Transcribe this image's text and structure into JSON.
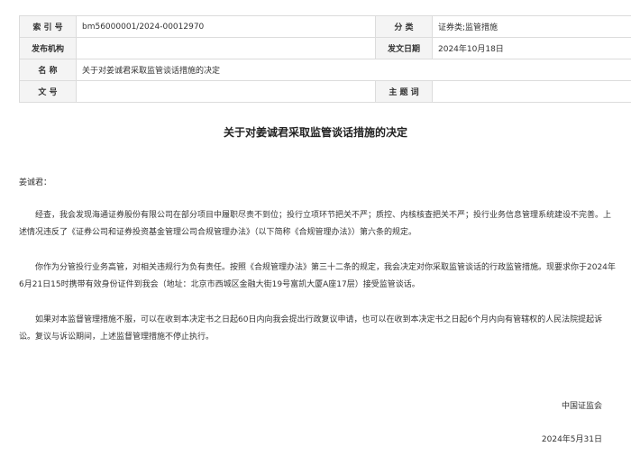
{
  "meta": {
    "index_label": "索 引 号",
    "index_value": "bm56000001/2024-00012970",
    "category_label": "分    类",
    "category_value": "证券类;监管措施",
    "issuer_label": "发布机构",
    "issuer_value": "",
    "date_label": "发文日期",
    "date_value": "2024年10月18日",
    "name_label": "名    称",
    "name_value": "关于对姜诚君采取监管谈话措施的决定",
    "docno_label": "文    号",
    "docno_value": "",
    "keywords_label": "主 题 词",
    "keywords_value": ""
  },
  "document": {
    "title": "关于对姜诚君采取监管谈话措施的决定",
    "salutation": "姜诚君：",
    "paragraphs": [
      "经查，我会发现海通证券股份有限公司在部分项目中履职尽责不到位；投行立项环节把关不严；质控、内核核查把关不严；投行业务信息管理系统建设不完善。上述情况违反了《证券公司和证券投资基金管理公司合规管理办法》（以下简称《合规管理办法》）第六条的规定。",
      "你作为分管投行业务高管，对相关违规行为负有责任。按照《合规管理办法》第三十二条的规定，我会决定对你采取监管谈话的行政监管措施。现要求你于2024年6月21日15时携带有效身份证件到我会（地址：北京市西城区金融大街19号富凯大厦A座17层）接受监管谈话。",
      "如果对本监督管理措施不服，可以在收到本决定书之日起60日内向我会提出行政复议申请，也可以在收到本决定书之日起6个月内向有管辖权的人民法院提起诉讼。复议与诉讼期间，上述监督管理措施不停止执行。"
    ],
    "signature": "中国证监会",
    "sign_date": "2024年5月31日"
  }
}
